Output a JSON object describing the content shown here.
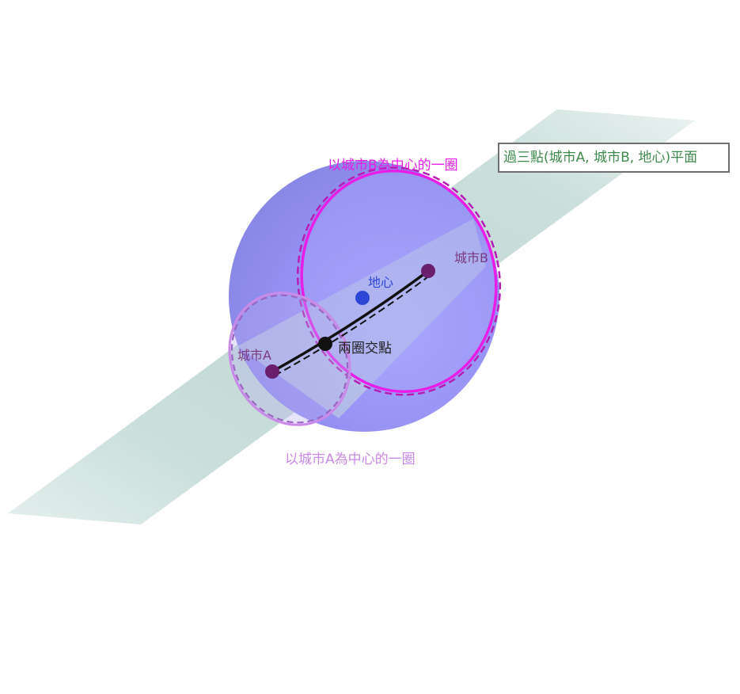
{
  "labels": {
    "circle_b": "以城市B為中心的一圈",
    "circle_a": "以城市A為中心的一圈",
    "plane": "過三點(城市A, 城市B, 地心)平面",
    "city_b": "城市B",
    "city_a": "城市A",
    "earth_center": "地心",
    "intersection": "兩圈交點"
  },
  "colors": {
    "sphere": "#8f8ef0",
    "plane": "#9cc3bd",
    "circle_b": "#e61ee6",
    "circle_a": "#c98ae8",
    "city_point": "#6a1f6e",
    "center_point": "#2c47d6",
    "intersection_point": "#111111",
    "plane_label_text": "#3f8a4e"
  }
}
